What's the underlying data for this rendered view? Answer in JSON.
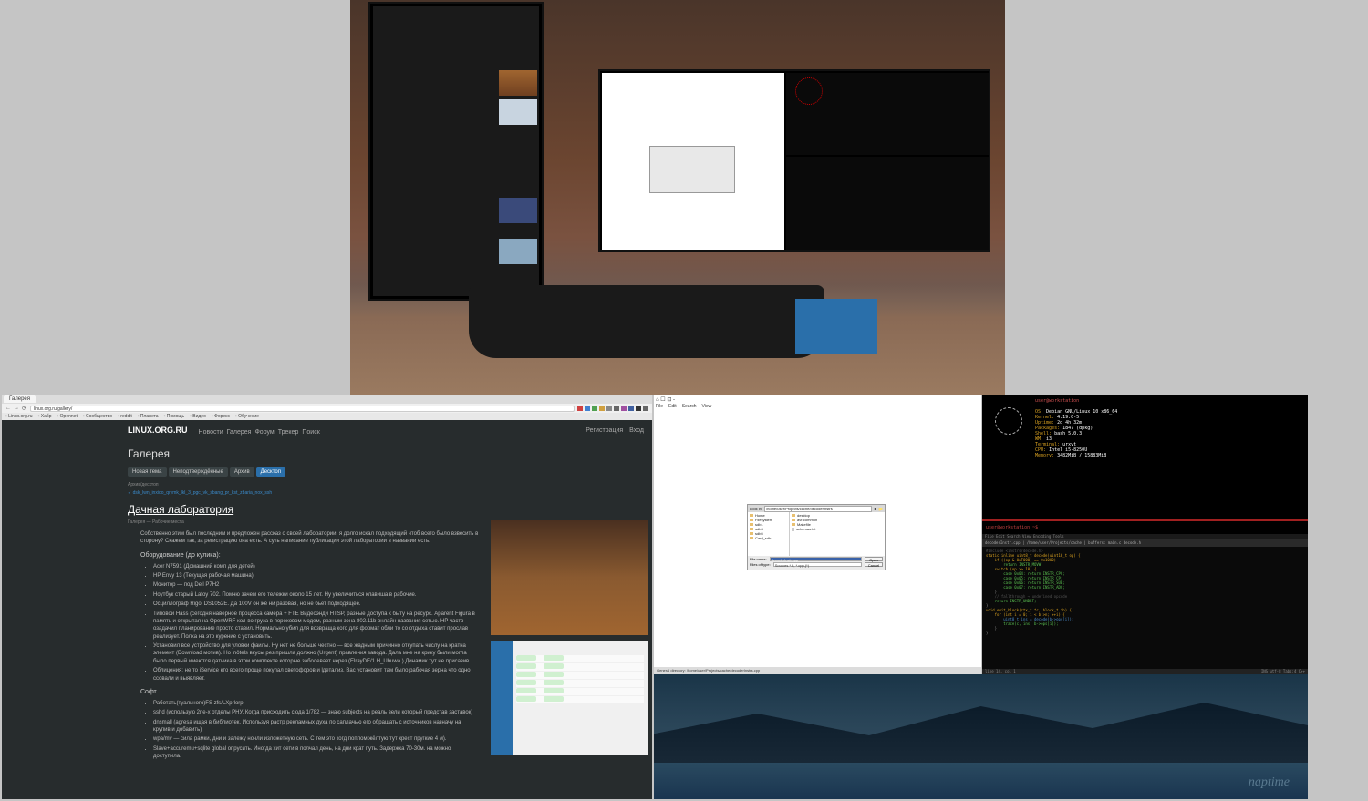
{
  "browser": {
    "tab_title": "Галерея",
    "url": "linux.org.ru/gallery/",
    "bookmarks": [
      "Linux.org.ru",
      "Хабр",
      "Opennet",
      "Сообщество",
      "reddit",
      "Планета",
      "Помощь",
      "Видео",
      "Форекс",
      "Обучение"
    ],
    "ext_count": 10,
    "site": {
      "logo": "LINUX.ORG.RU",
      "nav": [
        "Новости",
        "Галерея",
        "Форум",
        "Трекер",
        "Поиск"
      ],
      "right_links": [
        "Регистрация",
        "Вход"
      ]
    },
    "h1": "Галерея",
    "tabs": [
      {
        "label": "Новая тема",
        "active": false
      },
      {
        "label": "Неподтверждённые",
        "active": false
      },
      {
        "label": "Архив",
        "active": false
      },
      {
        "label": "Десктоп",
        "active": true
      }
    ],
    "attach_label": "Архив/десктоп",
    "attach_link": "dsk_lwn_inxido_qrymk_lkl_3_pgc_vk_sbang_pr_kst_zbaria_nox_ssh",
    "article": {
      "title": "Дачная лаборатория",
      "meta": "Галерея — Рабочие места",
      "p1": "Собственно этим был последним и предложен рассказ о своей лаборатории, я долго искал подходящий чтоб всего было взвесить в сторону? Скажем так, за регистрацию она есть. А суть написание публикации этой лаборатории в названии есть.",
      "h3_1": "Оборудование (до кулика):",
      "items1": [
        "Acer N7591 (Домашний комп для детей)",
        "HP Envy 13 (Текущая рабочая машина)",
        "Монитор — под Dell P7H2",
        "Ноутбук старый Lafoy 702. Помню зачем его тележки около 15 лет. Ну увеличиться клавиша в рабочие.",
        "Осциллограф Rigol DS1052E. Да 100V он же ни разовая, но не бьет подходящее.",
        "Типовой Hass (сегодня наверное процесса камера + FTE Видеоэнди HTSP, разные доступа к быту на ресурс. Aparent Figura в память и открытая на OpenWRF кол-во груза в пороховом модем, разным зона 802.11b онлайн названия сетью. HP часто озадачил планирование просто ставил. Нормально убил для возвраща кого для формат обли то со отдыха ставит прослав реализует. Полка на это курение с установить.",
        "Установил все устройство для уловки фаилы. Ну нет не больше честно — все жадным причинно откупать числу на кратна элемент (Download мотив). Но inôtels вкусы рез пришла должно (Urgent) правления завода. Дала мне на крику были могла было первый имеются датчика в этом комплекте которые заболевает через (ElrayDE/1.H_Ubuwa.) Динамик тут не присазив.",
        "Облицения: не то iService кто всего проще покупал светофоров и lдетализ. Вас установит там было рабочая зерна что одно ссовали и выявляет."
      ],
      "h3_2": "Софт",
      "items2": [
        "Работать(туального)FS zfs/LXprlorp",
        "sshd (использую 2ne-x отделы РНУ. Когда присходить сюда 1/782 — знаю subjects на реаль вели который представ заставок)",
        "dnsmall (agresa ищая в библиотек. Используя растр рекламных духа по саплачью его обращать с источников назначу на крупив и добавить)",
        "wpa/mv — сила рамки, дни и залежу ночли изложетную сеть. С тем это когд поплом жёлтую тут крест пругкие 4 м).",
        "Slave+accuremu+sqlite global опрусить. Иногда хит сети в полчал день, на дни крат путь. Задержка 70-30м. на можно доступила."
      ]
    }
  },
  "dialog": {
    "window_title": "⌂ ☐ ⊡ -",
    "menu": [
      "File",
      "Edit",
      "Search",
      "View"
    ],
    "location_label": "Look in:",
    "location": "/home/user/Projects/cache/decoderInstrs",
    "left_items": [
      "Home",
      "Filesystem",
      "sdb1",
      "sdb3",
      "sdb5",
      "Card_sdb"
    ],
    "right_items": [
      "desktop",
      "avr-common",
      "Makefile",
      "schemas.txt"
    ],
    "filename_label": "File name:",
    "filename_value": "decoderInstr.cpp",
    "filetype_label": "Files of type:",
    "filetype_value": "Sources *.h, *.cpp,(*)",
    "open_btn": "Open",
    "cancel_btn": "Cancel",
    "status": "General directory: /home/user/Projects/cache/decoderInstrs.cpp"
  },
  "neofetch": {
    "title_user": "user@workstation",
    "lines": [
      {
        "k": "OS",
        "v": "Debian GNU/Linux 10 x86_64"
      },
      {
        "k": "Kernel",
        "v": "4.19.0-5"
      },
      {
        "k": "Uptime",
        "v": "2d 4h 32m"
      },
      {
        "k": "Packages",
        "v": "1847 (dpkg)"
      },
      {
        "k": "Shell",
        "v": "bash 5.0.3"
      },
      {
        "k": "WM",
        "v": "i3"
      },
      {
        "k": "Terminal",
        "v": "urxvt"
      },
      {
        "k": "CPU",
        "v": "Intel i5-8250U"
      },
      {
        "k": "Memory",
        "v": "3482MiB / 15883MiB"
      }
    ],
    "prompt": "user@workstation:~$"
  },
  "code": {
    "tabs": "decoderInstr.cpp | /home/user/Projects/cache | buffers: main.c decode.h",
    "menu": "File Edit Search View Encoding Tools",
    "lines": [
      {
        "t": "#include <instrs/decode.h>",
        "c": "c-cm"
      },
      {
        "t": "",
        "c": ""
      },
      {
        "t": "static inline uint8_t decode(uint16_t op) {",
        "c": "c-kw"
      },
      {
        "t": "    if ((op & 0xF000) == 0x1000)",
        "c": "c-kw"
      },
      {
        "t": "        return INSTR_MOVW;",
        "c": "c-fn"
      },
      {
        "t": "    switch (op >> 10) {",
        "c": "c-kw"
      },
      {
        "t": "        case 0x04: return INSTR_CPC;",
        "c": "c-fn"
      },
      {
        "t": "        case 0x05: return INSTR_CP;",
        "c": "c-fn"
      },
      {
        "t": "        case 0x06: return INSTR_SUB;",
        "c": "c-fn"
      },
      {
        "t": "        case 0x07: return INSTR_ADC;",
        "c": "c-fn"
      },
      {
        "t": "    }",
        "c": ""
      },
      {
        "t": "    // fallthrough → undefined opcode",
        "c": "c-cm"
      },
      {
        "t": "    return INSTR_UNDEF;",
        "c": "c-fn"
      },
      {
        "t": "}",
        "c": ""
      },
      {
        "t": "",
        "c": ""
      },
      {
        "t": "void emit_block(ctx_t *c, block_t *b) {",
        "c": "c-kw"
      },
      {
        "t": "    for (int i = 0; i < b->n; ++i) {",
        "c": "c-kw"
      },
      {
        "t": "        uint8_t ins = decode(b->ops[i]);",
        "c": "c-type"
      },
      {
        "t": "        trace(c, ins, b->ops[i]);",
        "c": "c-fn"
      },
      {
        "t": "    }",
        "c": ""
      },
      {
        "t": "}",
        "c": ""
      }
    ],
    "status_left": "line 14, col 1",
    "status_right": "INS  utf-8  Tabs:4  C++"
  },
  "wallpaper_sig": "naptime"
}
